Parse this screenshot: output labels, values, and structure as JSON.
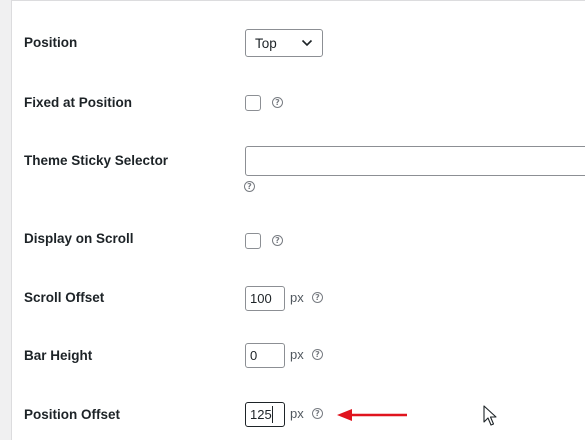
{
  "rows": {
    "position": {
      "label": "Position",
      "value": "Top"
    },
    "fixed_at_position": {
      "label": "Fixed at Position",
      "checked": false
    },
    "theme_sticky_selector": {
      "label": "Theme Sticky Selector",
      "value": ""
    },
    "display_on_scroll": {
      "label": "Display on Scroll",
      "checked": false
    },
    "scroll_offset": {
      "label": "Scroll Offset",
      "value": "100",
      "unit": "px"
    },
    "bar_height": {
      "label": "Bar Height",
      "value": "0",
      "unit": "px"
    },
    "position_offset": {
      "label": "Position Offset",
      "value": "125",
      "unit": "px"
    }
  },
  "help_glyph": "?",
  "icons": {
    "help": "question-circle-icon",
    "select_arrow": "chevron-down-icon",
    "annotation": "red-arrow-icon",
    "pointer": "mouse-cursor-icon"
  },
  "colors": {
    "annotation_arrow": "#e0141e",
    "border": "#8c8f94"
  }
}
